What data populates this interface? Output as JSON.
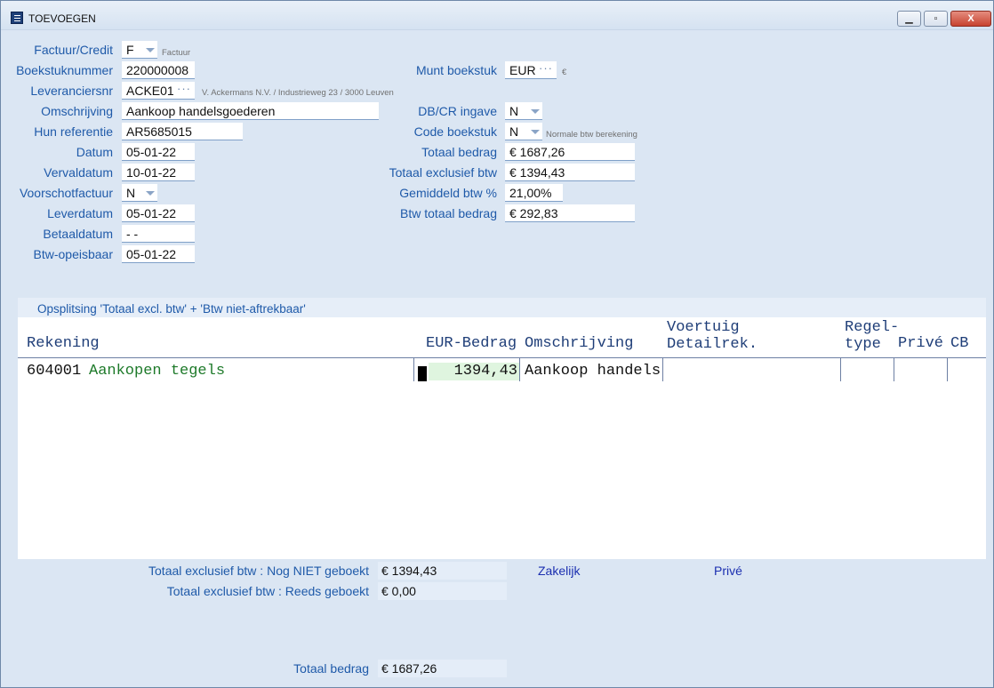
{
  "window": {
    "title": "TOEVOEGEN",
    "min_label": "▁",
    "max_label": "▫",
    "close_label": "X"
  },
  "form": {
    "factuur_credit": {
      "label": "Factuur/Credit",
      "value": "F",
      "note": "Factuur"
    },
    "boekstuknummer": {
      "label": "Boekstuknummer",
      "value": "220000008"
    },
    "leveranciersnr": {
      "label": "Leveranciersnr",
      "value": "ACKE01",
      "note": "V. Ackermans N.V. / Industrieweg 23 / 3000 Leuven"
    },
    "omschrijving": {
      "label": "Omschrijving",
      "value": "Aankoop handelsgoederen"
    },
    "hun_referentie": {
      "label": "Hun referentie",
      "value": "AR5685015"
    },
    "datum": {
      "label": "Datum",
      "value": "05-01-22"
    },
    "vervaldatum": {
      "label": "Vervaldatum",
      "value": "10-01-22"
    },
    "voorschotfactuur": {
      "label": "Voorschotfactuur",
      "value": "N"
    },
    "leverdatum": {
      "label": "Leverdatum",
      "value": "05-01-22"
    },
    "betaaldatum": {
      "label": "Betaaldatum",
      "value": "-  -"
    },
    "btw_opeisbaar": {
      "label": "Btw-opeisbaar",
      "value": "05-01-22"
    },
    "munt_boekstuk": {
      "label": "Munt boekstuk",
      "value": "EUR",
      "note": "€"
    },
    "dbcr_ingave": {
      "label": "DB/CR ingave",
      "value": "N"
    },
    "code_boekstuk": {
      "label": "Code boekstuk",
      "value": "N",
      "note": "Normale btw berekening"
    },
    "totaal_bedrag": {
      "label": "Totaal bedrag",
      "value": "€ 1687,26"
    },
    "totaal_excl_btw": {
      "label": "Totaal exclusief btw",
      "value": "€ 1394,43"
    },
    "gemiddeld_btw": {
      "label": "Gemiddeld btw %",
      "value": "21,00%"
    },
    "btw_totaal_bedrag": {
      "label": "Btw totaal bedrag",
      "value": "€ 292,83"
    }
  },
  "grid": {
    "title": "Opsplitsing 'Totaal excl. btw' + 'Btw niet-aftrekbaar'",
    "headers": {
      "rekening": "Rekening",
      "bedrag": "EUR-Bedrag",
      "omschrijving": "Omschrijving",
      "voertuig_1": "Voertuig",
      "voertuig_2": "Detailrek.",
      "regeltype_1": "Regel-",
      "regeltype_2": "type",
      "prive": "Privé",
      "cb": "CB"
    },
    "rows": [
      {
        "rekening_nr": "604001",
        "rekening_naam": "Aankopen tegels",
        "bedrag": "1394,43",
        "omschrijving": "Aankoop handels"
      }
    ]
  },
  "summary": {
    "nog_niet_geboekt": {
      "label": "Totaal exclusief btw : Nog NIET geboekt",
      "value": "€ 1394,43"
    },
    "reeds_geboekt": {
      "label": "Totaal exclusief btw : Reeds geboekt",
      "value": "€ 0,00"
    },
    "zakelijk": "Zakelijk",
    "prive": "Privé",
    "totaal_bedrag": {
      "label": "Totaal bedrag",
      "value": "€ 1687,26"
    }
  }
}
